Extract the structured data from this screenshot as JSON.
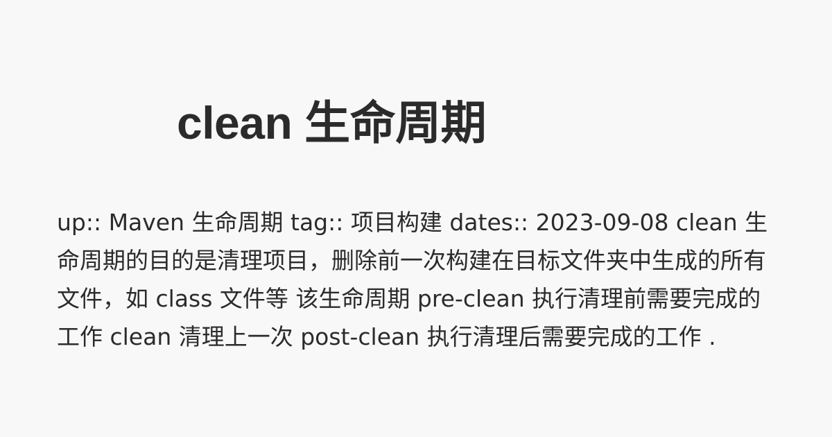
{
  "page": {
    "title": "clean 生命周期",
    "excerpt": "up:: Maven 生命周期 tag:: 项目构建 dates:: 2023-09-08 clean 生命周期的目的是清理项目，删除前一次构建在目标文件夹中生成的所有文件，如 class 文件等 该生命周期 pre-clean 执行清理前需要完成的工作 clean 清理上一次 post-clean 执行清理后需要完成的工作 ."
  }
}
